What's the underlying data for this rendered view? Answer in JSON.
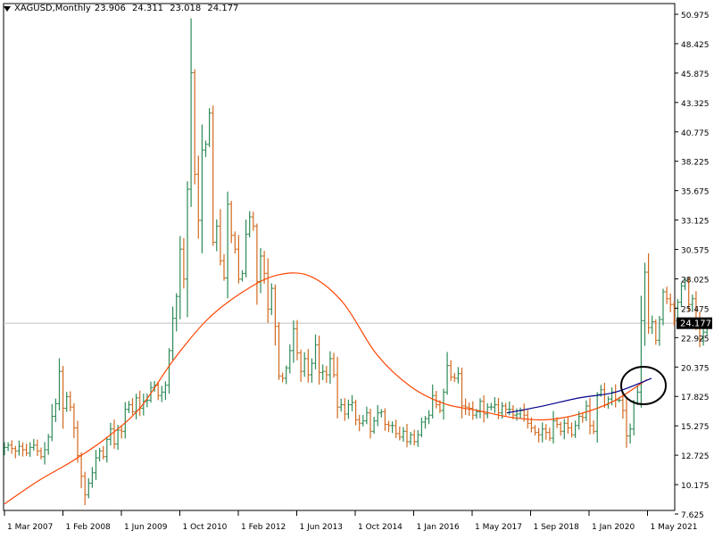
{
  "header": {
    "symbol_label": "XAGUSD,Monthly",
    "open": "23.906",
    "high": "24.311",
    "low": "23.018",
    "close": "24.177",
    "menu_icon": "triangle-down-icon"
  },
  "colors": {
    "bull": "#2e8b57",
    "bear": "#d2691e",
    "ma_slow": "#ff4500",
    "ma_fast": "#00008b",
    "price_line": "#c0c0c0",
    "annotation": "#000000"
  },
  "price_label": "24.177",
  "chart_data": {
    "type": "ohlc",
    "symbol": "XAGUSD",
    "timeframe": "Monthly",
    "y_ticks": [
      "50.975",
      "48.425",
      "45.875",
      "43.325",
      "40.775",
      "38.225",
      "35.675",
      "33.125",
      "30.575",
      "28.025",
      "25.475",
      "22.925",
      "20.375",
      "17.825",
      "15.275",
      "12.725",
      "10.175",
      "7.625"
    ],
    "x_ticks": [
      "1 Mar 2007",
      "1 Feb 2008",
      "1 Jun 2009",
      "1 Oct 2010",
      "1 Feb 2012",
      "1 Jun 2013",
      "1 Oct 2014",
      "1 Jan 2016",
      "1 May 2017",
      "1 Sep 2018",
      "1 Jan 2020",
      "1 May 2021"
    ],
    "ylim": [
      7.625,
      50.975
    ],
    "current_price": 24.177,
    "closes": [
      13.4,
      13.6,
      13.3,
      13.1,
      13.5,
      13.2,
      12.9,
      13.4,
      13.6,
      13.1,
      12.6,
      13.2,
      14.3,
      16.1,
      17.2,
      20.0,
      16.8,
      17.8,
      16.9,
      15.1,
      12.7,
      10.9,
      9.3,
      10.3,
      11.2,
      12.5,
      13.1,
      12.6,
      14.1,
      15.0,
      13.7,
      14.9,
      14.8,
      16.7,
      17.1,
      16.5,
      17.7,
      16.8,
      17.4,
      17.5,
      18.6,
      18.8,
      17.9,
      18.2,
      18.8,
      21.8,
      24.6,
      26.5,
      30.6,
      28.0,
      35.8,
      45.9,
      37.1,
      33.1,
      39.2,
      39.7,
      42.4,
      31.2,
      32.6,
      29.6,
      28.1,
      34.5,
      31.8,
      30.6,
      28.0,
      28.5,
      31.9,
      33.4,
      32.6,
      27.8,
      30.0,
      28.5,
      25.4,
      27.2,
      23.9,
      19.6,
      19.4,
      20.3,
      21.8,
      23.7,
      21.6,
      20.0,
      21.1,
      19.7,
      20.7,
      22.3,
      19.9,
      20.0,
      19.7,
      21.1,
      19.7,
      16.9,
      17.1,
      16.3,
      17.1,
      17.3,
      15.8,
      15.5,
      15.7,
      16.4,
      14.8,
      15.7,
      16.4,
      16.5,
      15.4,
      15.3,
      15.3,
      14.6,
      14.3,
      14.8,
      13.9,
      14.5,
      13.9,
      14.5,
      15.6,
      15.9,
      16.2,
      17.9,
      17.1,
      16.6,
      18.2,
      20.5,
      19.5,
      19.4,
      19.8,
      17.0,
      16.9,
      16.8,
      16.2,
      16.5,
      17.4,
      16.3,
      16.9,
      16.9,
      17.1,
      16.4,
      17.0,
      16.7,
      16.7,
      16.2,
      16.3,
      16.6,
      16.2,
      15.5,
      15.1,
      14.7,
      14.5,
      15.0,
      14.7,
      14.2,
      15.7,
      15.4,
      14.8,
      15.5,
      15.1,
      14.5,
      15.3,
      16.1,
      16.0,
      17.0,
      15.3,
      14.8,
      18.0,
      18.4,
      17.1,
      17.6,
      18.2,
      17.5,
      17.5,
      16.6,
      14.4,
      15.0,
      17.3,
      18.2,
      24.4,
      28.6,
      23.8,
      24.3,
      22.7,
      24.5,
      26.9,
      26.3,
      25.8,
      24.4,
      26.0,
      27.4,
      27.9,
      25.8,
      26.3,
      24.3,
      22.8,
      23.4,
      24.2
    ],
    "ma_slow": [
      8.5,
      10.5,
      12.2,
      14.2,
      16.8,
      21.0,
      24.5,
      26.8,
      28.3,
      28.3,
      26.0,
      21.5,
      18.7,
      17.2,
      16.6,
      16.0,
      15.8,
      16.3,
      17.4,
      19.3
    ],
    "ma_fast": [
      16.4,
      17.0,
      17.7,
      18.2,
      19.4
    ],
    "annotation": "circle"
  }
}
